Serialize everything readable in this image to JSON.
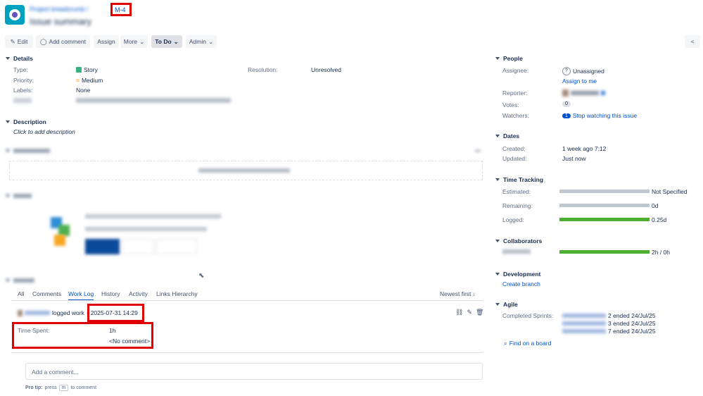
{
  "issue": {
    "breadcrumb_project": "Project breadcrumb",
    "breadcrumb_sep": " / ",
    "issue_key_prefix": "",
    "issue_key": "M-4",
    "summary": "Issue summary"
  },
  "toolbar": {
    "edit": "Edit",
    "add_comment": "Add comment",
    "assign": "Assign",
    "more": "More",
    "todo": "To Do",
    "admin": "Admin"
  },
  "details": {
    "heading": "Details",
    "type_label": "Type:",
    "type_value": "Story",
    "priority_label": "Priority:",
    "priority_value": "Medium",
    "labels_label": "Labels:",
    "labels_value": "None",
    "resolution_label": "Resolution:",
    "resolution_value": "Unresolved",
    "hidden_label": "",
    "hidden_value": ""
  },
  "description": {
    "heading": "Description",
    "placeholder": "Click to add description"
  },
  "attachments": {
    "heading": "",
    "drop_text": ""
  },
  "timesection": {
    "heading": "",
    "line1": "",
    "line2": "",
    "btn1": "",
    "btn2": "",
    "btn3": ""
  },
  "activity": {
    "heading": "",
    "tabs": [
      "All",
      "Comments",
      "Work Log",
      "History",
      "Activity",
      "Links Hierarchy"
    ],
    "sort": "Newest first",
    "user": "",
    "logged_work": "logged work",
    "sep": " - ",
    "timestamp": "2025-07-31 14:29",
    "time_spent_label": "Time Spent:",
    "time_spent_value": "1h",
    "no_comment": "<No comment>",
    "comment_placeholder": "Add a comment...",
    "protip_label": "Pro tip:",
    "protip_press": "press",
    "protip_key": "m",
    "protip_rest": "to comment"
  },
  "people": {
    "heading": "People",
    "assignee_label": "Assignee:",
    "assignee_value": "Unassigned",
    "assign_to_me": "Assign to me",
    "reporter_label": "Reporter:",
    "reporter_value": "",
    "votes_label": "Votes:",
    "votes_value": "0",
    "watchers_label": "Watchers:",
    "watchers_count": "1",
    "watchers_action": "Stop watching this issue"
  },
  "dates": {
    "heading": "Dates",
    "created_label": "Created:",
    "created_value": "1 week ago 7:12",
    "updated_label": "Updated:",
    "updated_value": "Just now"
  },
  "time_tracking": {
    "heading": "Time Tracking",
    "estimated_label": "Estimated:",
    "estimated_value": "Not Specified",
    "remaining_label": "Remaining:",
    "remaining_value": "0d",
    "logged_label": "Logged:",
    "logged_value": "0.25d",
    "logged_fraction": 1.0
  },
  "collaborators": {
    "heading": "Collaborators",
    "user": "",
    "value": "2h / 0h"
  },
  "development": {
    "heading": "Development",
    "create_branch": "Create branch"
  },
  "agile": {
    "heading": "Agile",
    "completed_label": "Completed Sprints:",
    "sprints": [
      {
        "name": "",
        "ended": "2 ended 24/Jul/25"
      },
      {
        "name": "",
        "ended": "3 ended 24/Jul/25"
      },
      {
        "name": "",
        "ended": "7 ended 24/Jul/25"
      }
    ],
    "find_on_board": "Find on a board"
  },
  "colors": {
    "link": "#0052cc",
    "highlight": "#e00000",
    "progress_green": "#4caf2f",
    "progress_grey": "#c1c7d0",
    "avatar": "#00a3bf"
  }
}
